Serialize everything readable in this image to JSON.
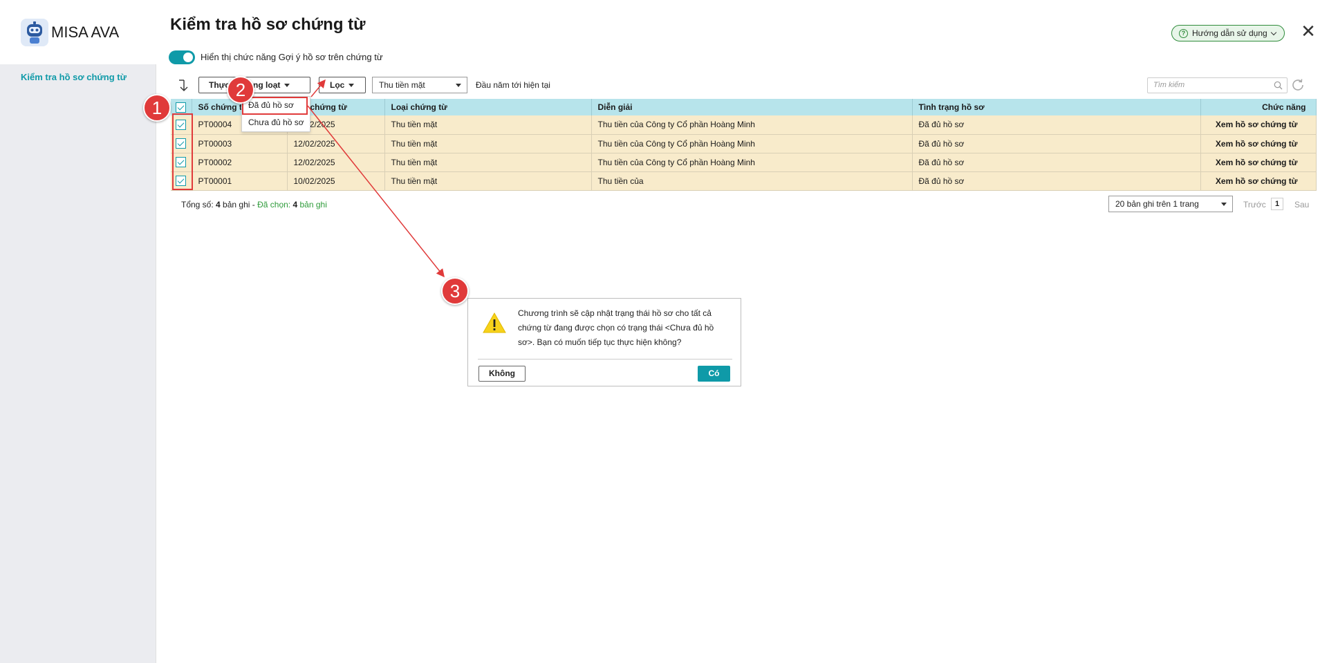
{
  "app": {
    "name": "MISA AVA"
  },
  "sidebar": {
    "items": [
      {
        "label": "Kiểm tra hồ sơ chứng từ"
      }
    ]
  },
  "header": {
    "title": "Kiểm tra hồ sơ chứng từ",
    "help_label": "Hướng dẫn sử dụng"
  },
  "toggle": {
    "label": "Hiển thị chức năng Gợi ý hồ sơ trên chứng từ",
    "on": true
  },
  "toolbar": {
    "batch_label": "Thực hiện hàng loạt",
    "batch_label_visible": "Thực      hàng loạt",
    "filter_label": "Lọc",
    "type_select": "Thu tiền mặt",
    "date_range": "Đầu năm tới hiện tại",
    "search_placeholder": "Tìm kiếm"
  },
  "dropdown": {
    "items": [
      "Đã đủ hồ sơ",
      "Chưa đủ hồ sơ"
    ]
  },
  "table": {
    "headers": {
      "doc_no": "Số chứng từ",
      "doc_no_visible": "Số chứng t",
      "date": "Ngày chứng từ",
      "date_visible": "gày chứng từ",
      "type": "Loại chứng từ",
      "desc": "Diễn giải",
      "status": "Tình trạng hồ sơ",
      "action": "Chức năng"
    },
    "rows": [
      {
        "doc_no": "PT00004",
        "date": "18/02/2025",
        "type": "Thu tiền mặt",
        "desc": "Thu tiền của Công ty Cổ phần Hoàng Minh",
        "status": "Đã đủ hồ sơ",
        "action": "Xem hồ sơ chứng từ"
      },
      {
        "doc_no": "PT00003",
        "date": "12/02/2025",
        "type": "Thu tiền mặt",
        "desc": "Thu tiền của Công ty Cổ phần Hoàng Minh",
        "status": "Đã đủ hồ sơ",
        "action": "Xem hồ sơ chứng từ"
      },
      {
        "doc_no": "PT00002",
        "date": "12/02/2025",
        "type": "Thu tiền mặt",
        "desc": "Thu tiền của Công ty Cổ phần Hoàng Minh",
        "status": "Đã đủ hồ sơ",
        "action": "Xem hồ sơ chứng từ"
      },
      {
        "doc_no": "PT00001",
        "date": "10/02/2025",
        "type": "Thu tiền mặt",
        "desc": "Thu tiền của",
        "status": "Đã đủ hồ sơ",
        "action": "Xem hồ sơ chứng từ"
      }
    ]
  },
  "footer": {
    "total_prefix": "Tổng số: ",
    "total_count": "4",
    "total_suffix": " bản ghi - ",
    "selected_prefix": "Đã chọn: ",
    "selected_count": "4",
    "selected_suffix": " bản ghi",
    "page_size": "20 bản ghi trên 1 trang",
    "prev": "Trước",
    "page": "1",
    "next": "Sau"
  },
  "dialog": {
    "message": "Chương trình sẽ cập nhật trạng thái hồ sơ cho tất cả chứng từ đang được chọn có trạng thái <Chưa đủ hồ sơ>. Bạn có muốn tiếp tục thực hiện không?",
    "no_label": "Không",
    "yes_label": "Có"
  },
  "callouts": [
    "1",
    "2",
    "3"
  ],
  "colors": {
    "accent": "#0f9aa8",
    "callout": "#e03a3a",
    "row_bg": "#f8ebcb",
    "header_bg": "#b7e4eb",
    "link": "#0d7bbf"
  }
}
